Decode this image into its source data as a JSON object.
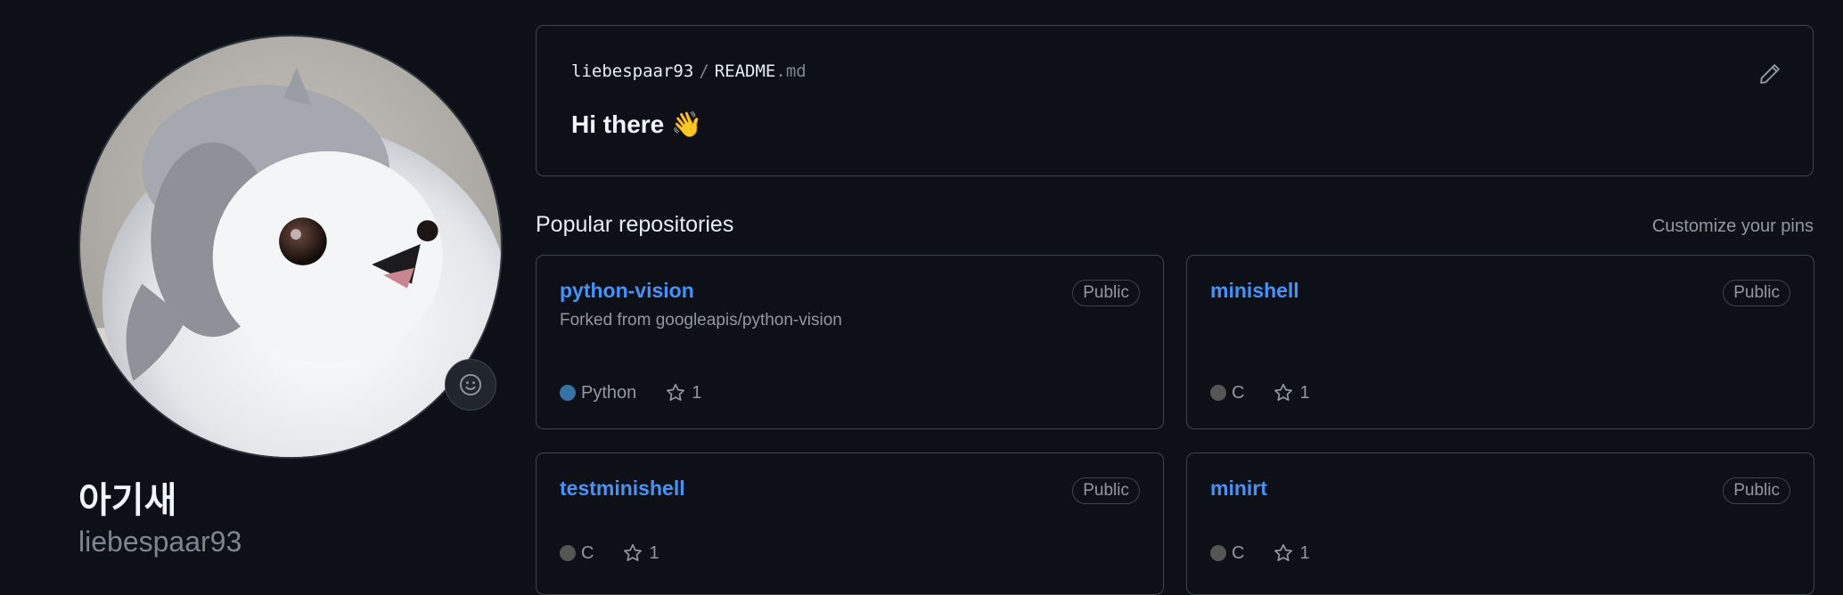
{
  "profile": {
    "display_name": "아기새",
    "username": "liebespaar93"
  },
  "readme": {
    "owner": "liebespaar93",
    "separator": "/",
    "file_base": "README",
    "file_ext": ".md",
    "heading": "Hi there",
    "heading_emoji": "👋"
  },
  "popular": {
    "title": "Popular repositories",
    "customize_label": "Customize your pins",
    "repos": [
      {
        "name": "python-vision",
        "visibility": "Public",
        "forked_from": "Forked from googleapis/python-vision",
        "language": "Python",
        "language_color": "#3572A5",
        "stars": "1"
      },
      {
        "name": "minishell",
        "visibility": "Public",
        "forked_from": "",
        "language": "C",
        "language_color": "#555555",
        "stars": "1"
      },
      {
        "name": "testminishell",
        "visibility": "Public",
        "forked_from": "",
        "language": "C",
        "language_color": "#555555",
        "stars": "1"
      },
      {
        "name": "minirt",
        "visibility": "Public",
        "forked_from": "",
        "language": "C",
        "language_color": "#555555",
        "stars": "1"
      }
    ]
  },
  "icons": {
    "avatar": "fluffy-bird-avatar",
    "status": "smiley-icon",
    "edit": "pencil-icon",
    "star": "star-icon"
  },
  "colors": {
    "background": "#0d1117",
    "border": "#3d444d",
    "link": "#4493f8",
    "muted": "#9198a1"
  }
}
